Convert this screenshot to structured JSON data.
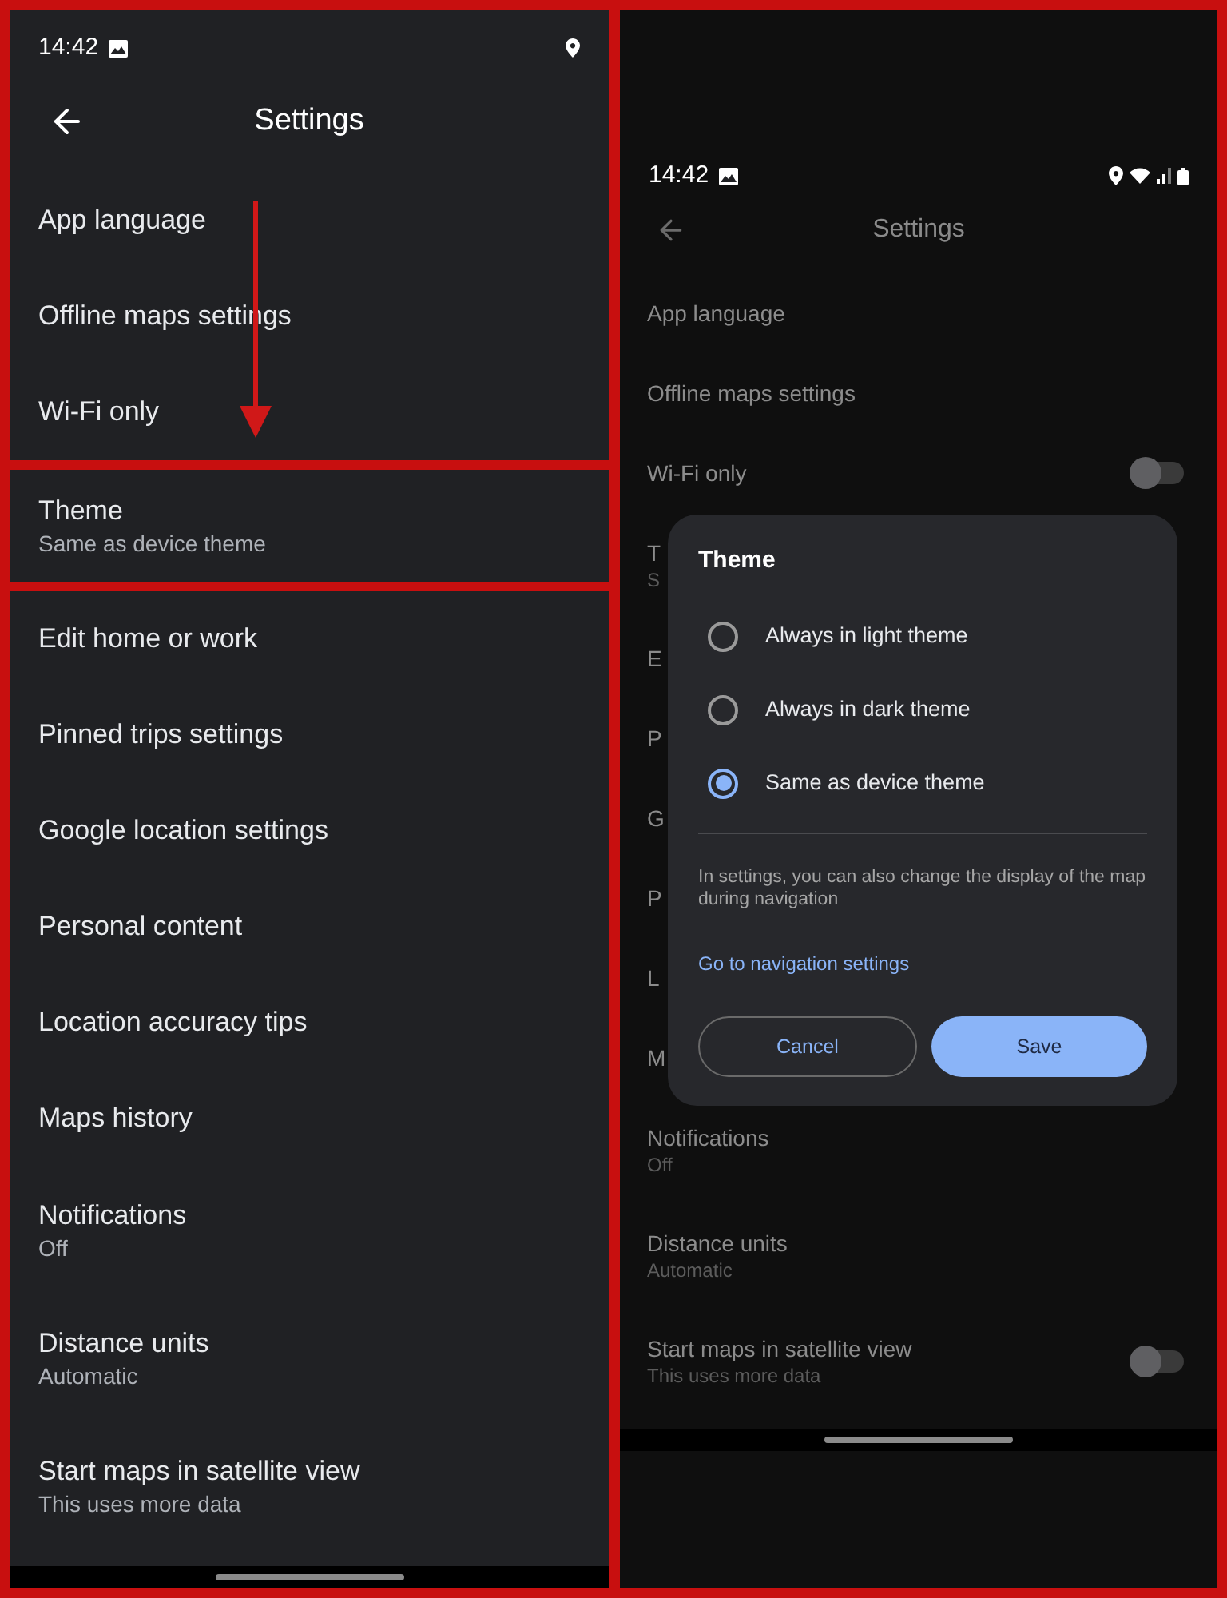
{
  "left_screen": {
    "status_bar": {
      "time": "14:42"
    },
    "title": "Settings",
    "groups": [
      {
        "items": [
          {
            "label": "App language"
          },
          {
            "label": "Offline maps settings"
          },
          {
            "label": "Wi-Fi only"
          }
        ]
      },
      {
        "items": [
          {
            "label": "Theme",
            "value": "Same as device theme"
          }
        ]
      },
      {
        "items": [
          {
            "label": "Edit home or work"
          },
          {
            "label": "Pinned trips settings"
          },
          {
            "label": "Google location settings"
          },
          {
            "label": "Personal content"
          },
          {
            "label": "Location accuracy tips"
          },
          {
            "label": "Maps history"
          },
          {
            "label": "Notifications",
            "value": "Off"
          },
          {
            "label": "Distance units",
            "value": "Automatic"
          },
          {
            "label": "Start maps in satellite view",
            "value": "This uses more data"
          }
        ]
      }
    ]
  },
  "right_screen": {
    "status_bar": {
      "time": "14:42"
    },
    "title": "Settings",
    "items": [
      {
        "label": "App language",
        "kind": "plain"
      },
      {
        "label": "Offline maps settings",
        "kind": "plain"
      },
      {
        "label": "Wi-Fi only",
        "kind": "toggle",
        "on": false
      },
      {
        "label": "T",
        "value": "S",
        "kind": "plain"
      },
      {
        "label": "E",
        "kind": "plain"
      },
      {
        "label": "P",
        "kind": "plain"
      },
      {
        "label": "G",
        "kind": "plain"
      },
      {
        "label": "P",
        "kind": "plain"
      },
      {
        "label": "L",
        "kind": "plain"
      },
      {
        "label": "M",
        "kind": "plain"
      },
      {
        "label": "Notifications",
        "value": "Off",
        "kind": "plain"
      },
      {
        "label": "Distance units",
        "value": "Automatic",
        "kind": "plain"
      },
      {
        "label": "Start maps in satellite view",
        "value": "This uses more data",
        "kind": "toggle",
        "on": false
      }
    ],
    "dialog": {
      "title": "Theme",
      "options": [
        {
          "label": "Always in light theme",
          "selected": false
        },
        {
          "label": "Always in dark theme",
          "selected": false
        },
        {
          "label": "Same as device theme",
          "selected": true
        }
      ],
      "note": "In settings, you can also change the display of the map during navigation",
      "link": "Go to navigation settings",
      "buttons": [
        {
          "label": "Cancel",
          "kind": "outlined"
        },
        {
          "label": "Save",
          "kind": "filled"
        }
      ]
    }
  }
}
